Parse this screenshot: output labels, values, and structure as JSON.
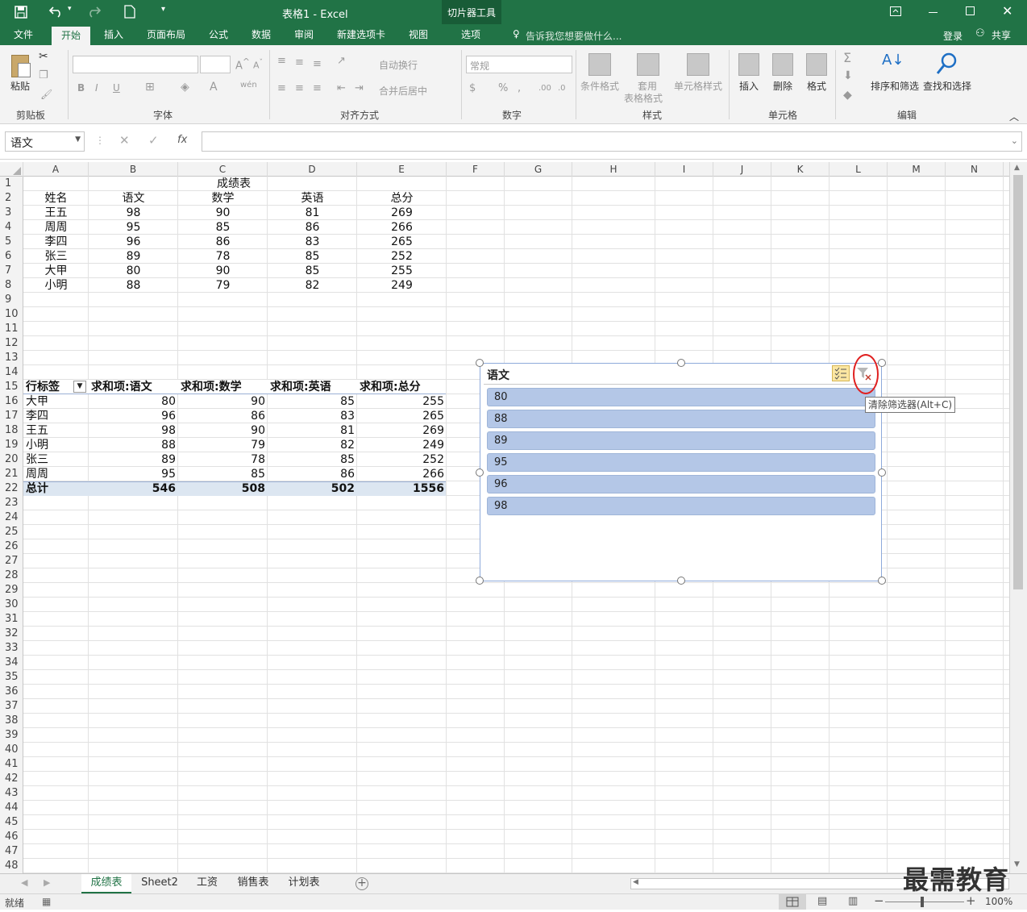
{
  "window": {
    "title": "表格1 - Excel",
    "context_tool": "切片器工具"
  },
  "ribbon_tabs": [
    "文件",
    "开始",
    "插入",
    "页面布局",
    "公式",
    "数据",
    "审阅",
    "新建选项卡",
    "视图",
    "选项"
  ],
  "tell_me": "告诉我您想要做什么...",
  "account": {
    "login": "登录",
    "share": "共享"
  },
  "ribbon": {
    "paste": "粘贴",
    "clipboard": "剪贴板",
    "font_group": "字体",
    "align_group": "对齐方式",
    "wrap": "自动换行",
    "merge": "合并后居中",
    "number_format": "常规",
    "number_group": "数字",
    "cond_format": "条件格式",
    "table_format_1": "套用",
    "table_format_2": "表格格式",
    "cell_style": "单元格样式",
    "styles_group": "样式",
    "insert": "插入",
    "delete": "删除",
    "format": "格式",
    "cells_group": "单元格",
    "sort_filter": "排序和筛选",
    "find_select": "查找和选择",
    "edit_group": "编辑",
    "bold": "B",
    "italic": "I",
    "underline": "U",
    "wen": "wén"
  },
  "formula_bar": {
    "name_box": "语文",
    "formula": "",
    "fx": "fx"
  },
  "columns": [
    "A",
    "B",
    "C",
    "D",
    "E",
    "F",
    "G",
    "H",
    "I",
    "J",
    "K",
    "L",
    "M",
    "N"
  ],
  "rows": [
    "1",
    "2",
    "3",
    "4",
    "5",
    "6",
    "7",
    "8",
    "9",
    "10",
    "11",
    "12",
    "13",
    "14",
    "15",
    "16",
    "17",
    "18",
    "19",
    "20",
    "21",
    "22",
    "23",
    "24",
    "25",
    "26",
    "27",
    "28",
    "29",
    "30",
    "31",
    "32",
    "33",
    "34",
    "35",
    "36",
    "37",
    "38",
    "39",
    "40",
    "41",
    "42",
    "43",
    "44",
    "45",
    "46",
    "47",
    "48"
  ],
  "sheet": {
    "title": "成绩表",
    "headers": [
      "姓名",
      "语文",
      "数学",
      "英语",
      "总分"
    ],
    "rows": [
      [
        "王五",
        "98",
        "90",
        "81",
        "269"
      ],
      [
        "周周",
        "95",
        "85",
        "86",
        "266"
      ],
      [
        "李四",
        "96",
        "86",
        "83",
        "265"
      ],
      [
        "张三",
        "89",
        "78",
        "85",
        "252"
      ],
      [
        "大甲",
        "80",
        "90",
        "85",
        "255"
      ],
      [
        "小明",
        "88",
        "79",
        "82",
        "249"
      ]
    ]
  },
  "pivot": {
    "headers": [
      "行标签",
      "求和项:语文",
      "求和项:数学",
      "求和项:英语",
      "求和项:总分"
    ],
    "rows": [
      [
        "大甲",
        "80",
        "90",
        "85",
        "255"
      ],
      [
        "李四",
        "96",
        "86",
        "83",
        "265"
      ],
      [
        "王五",
        "98",
        "90",
        "81",
        "269"
      ],
      [
        "小明",
        "88",
        "79",
        "82",
        "249"
      ],
      [
        "张三",
        "89",
        "78",
        "85",
        "252"
      ],
      [
        "周周",
        "95",
        "85",
        "86",
        "266"
      ]
    ],
    "total": [
      "总计",
      "546",
      "508",
      "502",
      "1556"
    ]
  },
  "slicer": {
    "title": "语文",
    "items": [
      "80",
      "88",
      "89",
      "95",
      "96",
      "98"
    ],
    "tooltip": "清除筛选器(Alt+C)"
  },
  "sheet_tabs": [
    "成绩表",
    "Sheet2",
    "工资",
    "销售表",
    "计划表"
  ],
  "status": {
    "ready": "就绪",
    "zoom": "100%"
  },
  "watermark": "最需教育",
  "colors": {
    "accent": "#217346",
    "slicer_item": "#b4c7e7",
    "highlight": "#e02020"
  }
}
